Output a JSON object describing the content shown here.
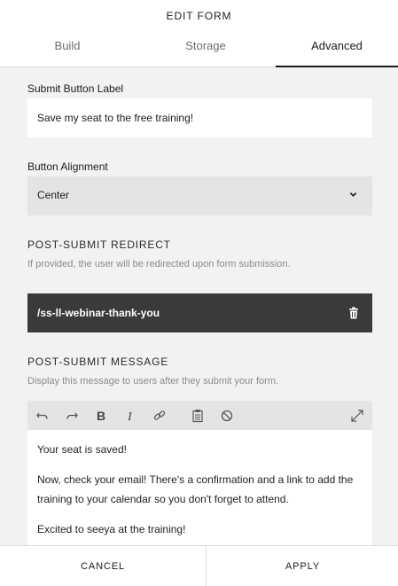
{
  "header": {
    "title": "EDIT FORM",
    "tabs": [
      {
        "label": "Build"
      },
      {
        "label": "Storage"
      },
      {
        "label": "Advanced",
        "active": true
      }
    ]
  },
  "submit_button_label": {
    "label": "Submit Button Label",
    "value": "Save my seat to the free training!"
  },
  "button_alignment": {
    "label": "Button Alignment",
    "selected": "Center"
  },
  "redirect": {
    "title": "POST-SUBMIT REDIRECT",
    "description": "If provided, the user will be redirected upon form submission.",
    "value": "/ss-ll-webinar-thank-you"
  },
  "message": {
    "title": "POST-SUBMIT MESSAGE",
    "description": "Display this message to users after they submit your form.",
    "toolbar_icons": [
      "undo-icon",
      "redo-icon",
      "bold-icon",
      "italic-icon",
      "link-icon",
      "paste-icon",
      "clear-format-icon",
      "expand-icon"
    ],
    "paragraphs": [
      "Your seat is saved!",
      "Now, check your email! There's a confirmation and a link to add the training to your calendar so you don't forget to attend.",
      "Excited to seeya at the training!"
    ]
  },
  "footer": {
    "cancel": "CANCEL",
    "apply": "APPLY"
  }
}
